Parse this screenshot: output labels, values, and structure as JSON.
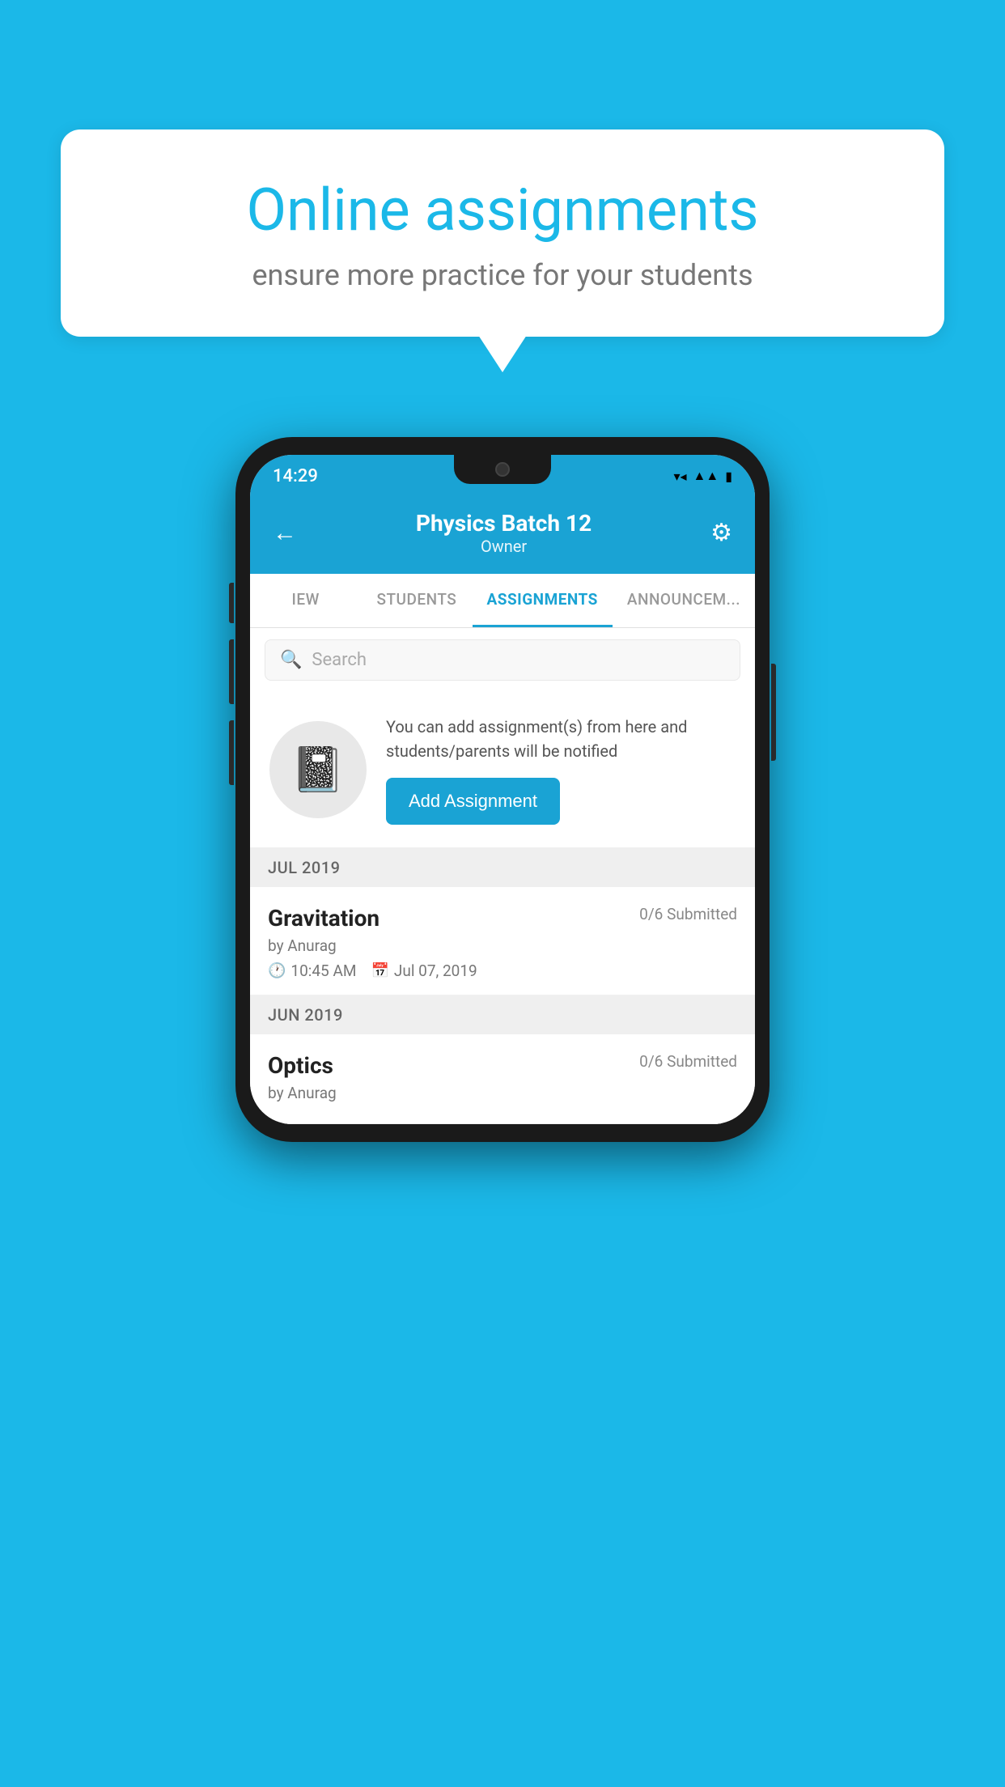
{
  "background_color": "#1bb8e8",
  "speech_bubble": {
    "title": "Online assignments",
    "subtitle": "ensure more practice for your students"
  },
  "phone": {
    "status_bar": {
      "time": "14:29",
      "icons": [
        "wifi",
        "signal",
        "battery"
      ]
    },
    "header": {
      "title": "Physics Batch 12",
      "subtitle": "Owner",
      "back_label": "←",
      "gear_label": "⚙"
    },
    "tabs": [
      {
        "label": "IEW",
        "active": false
      },
      {
        "label": "STUDENTS",
        "active": false
      },
      {
        "label": "ASSIGNMENTS",
        "active": true
      },
      {
        "label": "ANNOUNCEM...",
        "active": false
      }
    ],
    "search": {
      "placeholder": "Search"
    },
    "add_assignment_card": {
      "description": "You can add assignment(s) from here and students/parents will be notified",
      "button_label": "Add Assignment"
    },
    "assignment_sections": [
      {
        "month": "JUL 2019",
        "assignments": [
          {
            "name": "Gravitation",
            "submitted": "0/6 Submitted",
            "author": "by Anurag",
            "time": "10:45 AM",
            "date": "Jul 07, 2019"
          }
        ]
      },
      {
        "month": "JUN 2019",
        "assignments": [
          {
            "name": "Optics",
            "submitted": "0/6 Submitted",
            "author": "by Anurag",
            "time": "",
            "date": ""
          }
        ]
      }
    ]
  }
}
